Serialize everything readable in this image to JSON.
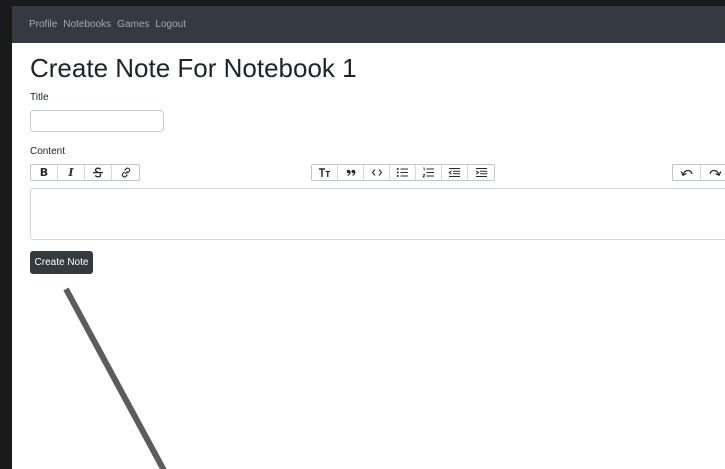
{
  "nav": {
    "links": [
      "Profile",
      "Notebooks",
      "Games",
      "Logout"
    ]
  },
  "page": {
    "title": "Create Note For Notebook 1"
  },
  "form": {
    "title_label": "Title",
    "title_value": "",
    "content_label": "Content",
    "submit_label": "Create Note"
  },
  "toolbar": {
    "bold": "B",
    "italic": "I"
  },
  "colors": {
    "navbar": "#343a40",
    "nav_link": "#a3a9ae",
    "button": "#343a40",
    "annotation_stroke": "#5c5c5c"
  }
}
